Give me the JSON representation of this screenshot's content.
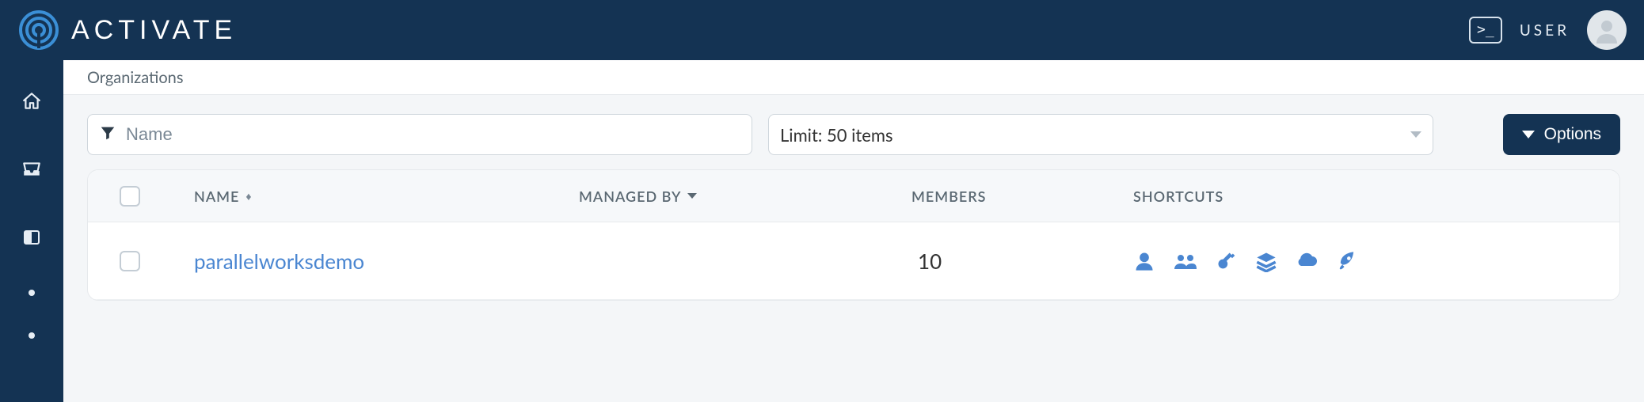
{
  "brand": {
    "name": "ACTIVATE"
  },
  "header": {
    "user_label": "USER",
    "terminal_glyph": ">_"
  },
  "breadcrumb": "Organizations",
  "filter": {
    "placeholder": "Name"
  },
  "limit": {
    "label": "Limit: 50 items"
  },
  "options_btn": "Options",
  "table": {
    "columns": {
      "name": "NAME",
      "managed_by": "MANAGED BY",
      "members": "MEMBERS",
      "shortcuts": "SHORTCUTS"
    },
    "rows": [
      {
        "name": "parallelworksdemo",
        "managed_by": "",
        "members": "10"
      }
    ]
  },
  "icon_names": {
    "sidebar": [
      "home-icon",
      "inbox-icon",
      "panel-icon",
      "dot-icon",
      "dot-icon"
    ],
    "shortcuts": [
      "user-icon",
      "users-icon",
      "key-icon",
      "layers-icon",
      "cloud-icon",
      "rocket-icon"
    ]
  }
}
